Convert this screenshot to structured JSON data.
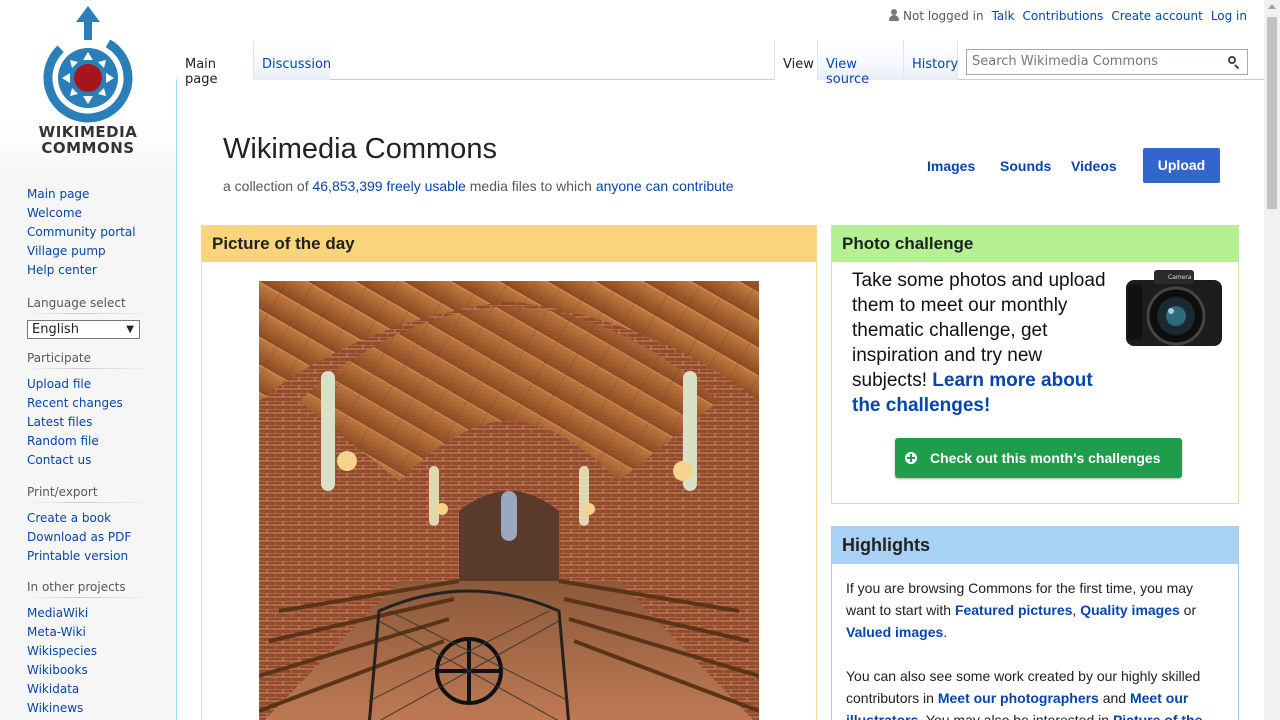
{
  "personal": {
    "not_logged_in": "Not logged in",
    "talk": "Talk",
    "contributions": "Contributions",
    "create_account": "Create account",
    "log_in": "Log in"
  },
  "logo": {
    "line1": "WIKIMEDIA",
    "line2": "COMMONS"
  },
  "tabs": {
    "main_page": "Main page",
    "discussion": "Discussion",
    "view": "View",
    "view_source": "View source",
    "history": "History"
  },
  "search": {
    "placeholder": "Search Wikimedia Commons"
  },
  "sidebar": {
    "navigation": [
      {
        "label": "Main page"
      },
      {
        "label": "Welcome"
      },
      {
        "label": "Community portal"
      },
      {
        "label": "Village pump"
      },
      {
        "label": "Help center"
      }
    ],
    "language": {
      "heading": "Language select",
      "selected": "English"
    },
    "participate": {
      "heading": "Participate",
      "items": [
        {
          "label": "Upload file"
        },
        {
          "label": "Recent changes"
        },
        {
          "label": "Latest files"
        },
        {
          "label": "Random file"
        },
        {
          "label": "Contact us"
        }
      ]
    },
    "print": {
      "heading": "Print/export",
      "items": [
        {
          "label": "Create a book"
        },
        {
          "label": "Download as PDF"
        },
        {
          "label": "Printable version"
        }
      ]
    },
    "other_projects": {
      "heading": "In other projects",
      "items": [
        {
          "label": "MediaWiki"
        },
        {
          "label": "Meta-Wiki"
        },
        {
          "label": "Wikispecies"
        },
        {
          "label": "Wikibooks"
        },
        {
          "label": "Wikidata"
        },
        {
          "label": "Wikinews"
        }
      ]
    }
  },
  "header": {
    "title": "Wikimedia Commons",
    "sub_prefix": "a collection of ",
    "file_count": "46,853,399",
    "freely_usable": "freely usable",
    "sub_middle": " media files to which ",
    "anyone_can_contribute": "anyone can contribute",
    "nav": {
      "images": "Images",
      "sounds": "Sounds",
      "videos": "Videos"
    },
    "upload": "Upload"
  },
  "potd": {
    "heading": "Picture of the day"
  },
  "photo_challenge": {
    "heading": "Photo challenge",
    "text": "Take some photos and upload them to meet our monthly thematic challenge, get inspiration and try new subjects! ",
    "link": "Learn more about the challenges!",
    "camera_label": "Camera",
    "button": "Check out this month's challenges"
  },
  "highlights": {
    "heading": "Highlights",
    "p1_start": "If you are browsing Commons for the first time, you may want to start with ",
    "featured": "Featured pictures",
    "sep1": ", ",
    "quality": "Quality images",
    "or": " or ",
    "valued": "Valued images",
    "p1_end": ".",
    "p2_start": "You can also see some work created by our highly skilled contributors in ",
    "photographers": "Meet our photographers",
    "and": " and ",
    "illustrators": "Meet our illustrators",
    "p2_mid": ". You may also be interested in ",
    "picture_of_the": "Picture of the"
  },
  "colors": {
    "link": "#0645ad",
    "potd_header": "#fad47a",
    "challenge_header": "#b5f092",
    "highlights_header": "#a9d1f3",
    "upload_button": "#3366cc",
    "challenge_button": "#1e9e4b"
  }
}
